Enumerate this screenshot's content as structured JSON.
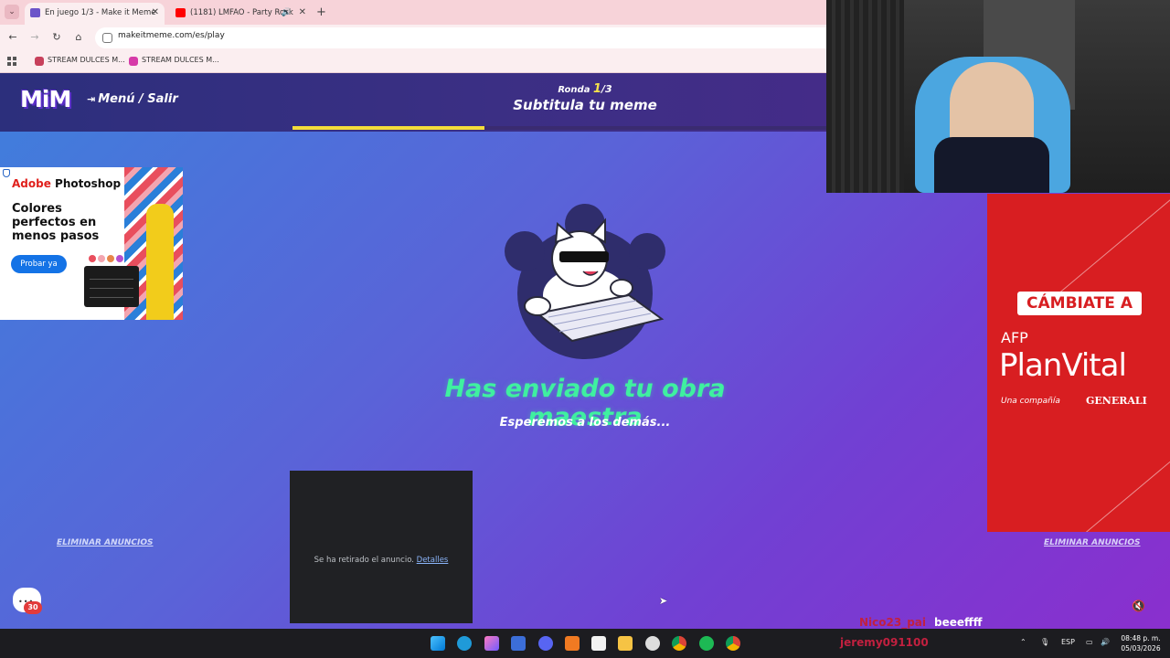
{
  "browser": {
    "tabs": [
      {
        "title": "En juego 1/3 - Make it Meme",
        "active": true
      },
      {
        "title": "(1181) LMFAO - Party Rock",
        "active": false
      }
    ],
    "url": "makeitmeme.com/es/play",
    "bookmarks": [
      {
        "label": "STREAM DULCES M...",
        "color": "#c7405b"
      },
      {
        "label": "STREAM DULCES M...",
        "color": "#d63aa8"
      }
    ]
  },
  "game": {
    "logo": "MiM",
    "menu_label": "Menú / Salir",
    "round_prefix": "Ronda",
    "round_current": "1",
    "round_total": "/3",
    "phase_title": "Subtitula tu meme",
    "progress_fraction": 0.36,
    "sent_title": "Has enviado tu obra maestra",
    "sent_subtitle": "Esperemos a los demás..."
  },
  "ads": {
    "photoshop": {
      "brand_prefix": "Adobe",
      "brand": "Photoshop",
      "headline": "Colores perfectos en menos pasos",
      "cta": "Probar ya"
    },
    "removed": {
      "message": "Se ha retirado el anuncio.",
      "link": "Detalles"
    },
    "planvital": {
      "cta": "CÁMBIATE A",
      "afp": "AFP",
      "brand": "PlanVital",
      "tagline": "Una compañía",
      "parent": "GENERALI"
    },
    "remove_ads_label": "ELIMINAR ANUNCIOS"
  },
  "chat_badge": "30",
  "stream_chat": [
    {
      "user": "Nico23_pai",
      "message": "beeeffff"
    },
    {
      "user": "jeremy091100",
      "message": ""
    }
  ],
  "taskbar": {
    "lang": "ESP",
    "time": "08:48 p. m.",
    "date": "05/03/2026"
  },
  "colors": {
    "accent_green": "#3ff0a0",
    "progress_yellow": "#f4dd3a",
    "planvital_red": "#d81e21"
  }
}
